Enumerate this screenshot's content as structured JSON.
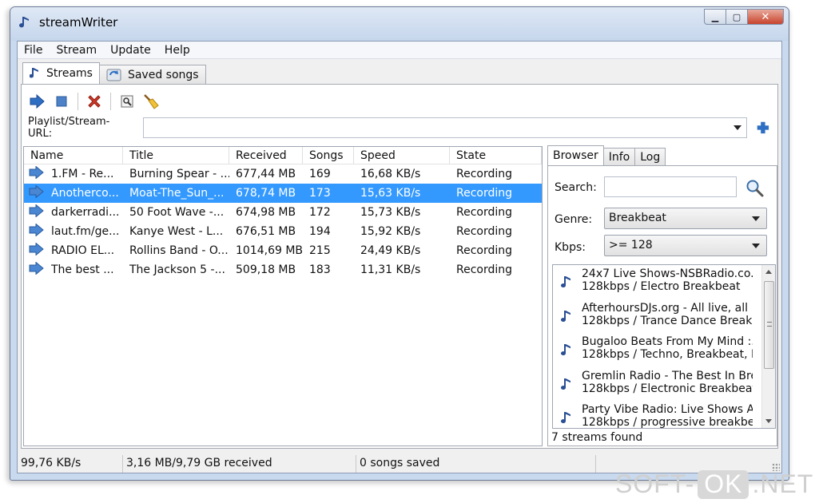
{
  "window": {
    "title": "streamWriter",
    "buttons": [
      "minimize",
      "maximize",
      "close"
    ]
  },
  "menu": [
    "File",
    "Stream",
    "Update",
    "Help"
  ],
  "tabs": [
    {
      "label": "Streams",
      "icon": "note-icon",
      "active": true
    },
    {
      "label": "Saved songs",
      "icon": "saved-songs-icon",
      "active": false
    }
  ],
  "toolbar": {
    "buttons": [
      "start-arrow-icon",
      "stop-square-icon",
      "delete-x-icon",
      "properties-icon",
      "cleanup-broom-icon"
    ]
  },
  "url": {
    "label": "Playlist/Stream-URL:",
    "value": "",
    "add_icon": "plus-icon"
  },
  "stream_list": {
    "columns": [
      "Name",
      "Title",
      "Received",
      "Songs",
      "Speed",
      "State"
    ],
    "rows": [
      {
        "name": "1.FM - Re...",
        "title": "Burning Spear - ...",
        "received": "677,44 MB",
        "songs": "169",
        "speed": "16,68 KB/s",
        "state": "Recording",
        "selected": false
      },
      {
        "name": "Anotherco...",
        "title": "Moat-The_Sun_...",
        "received": "678,74 MB",
        "songs": "173",
        "speed": "15,63 KB/s",
        "state": "Recording",
        "selected": true
      },
      {
        "name": "darkerradi...",
        "title": "50 Foot Wave -...",
        "received": "674,98 MB",
        "songs": "172",
        "speed": "15,73 KB/s",
        "state": "Recording",
        "selected": false
      },
      {
        "name": "laut.fm/ge...",
        "title": "Kanye West - L...",
        "received": "676,51 MB",
        "songs": "194",
        "speed": "15,92 KB/s",
        "state": "Recording",
        "selected": false
      },
      {
        "name": "RADIO EL...",
        "title": "Rollins Band - O...",
        "received": "1014,69 MB",
        "songs": "215",
        "speed": "24,49 KB/s",
        "state": "Recording",
        "selected": false
      },
      {
        "name": "The best ...",
        "title": "The Jackson 5 -...",
        "received": "509,18 MB",
        "songs": "183",
        "speed": "11,31 KB/s",
        "state": "Recording",
        "selected": false
      }
    ]
  },
  "browser": {
    "tabs": [
      "Browser",
      "Info",
      "Log"
    ],
    "search_label": "Search:",
    "search_value": "",
    "genre_label": "Genre:",
    "genre_value": "Breakbeat",
    "kbps_label": "Kbps:",
    "kbps_value": ">= 128",
    "results": [
      {
        "line1": "24x7 Live Shows-NSBRadio.co....",
        "line2": "128kbps / Electro Breakbeat"
      },
      {
        "line1": "AfterhoursDJs.org - All live, all ...",
        "line2": "128kbps / Trance Dance Breakbea"
      },
      {
        "line1": "Bugaloo Beats From My Mind :...",
        "line2": "128kbps / Techno, Breakbeat, Ho"
      },
      {
        "line1": "Gremlin Radio - The Best In Bre...",
        "line2": "128kbps / Electronic Breakbeat Te"
      },
      {
        "line1": "Party Vibe Radio: Live Shows A...",
        "line2": "128kbps / progressive breakbeat"
      }
    ],
    "found_text": "7 streams found"
  },
  "status": {
    "speed": "99,76 KB/s",
    "received": "3,16 MB/9,79 GB received",
    "saved": "0 songs saved"
  },
  "watermark": {
    "left": "SOFT-",
    "mid": "OK",
    "right": ".NET"
  },
  "colors": {
    "selection": "#3399ff",
    "arrow_blue": "#2e6fc4",
    "delete_red": "#d03a2a"
  }
}
